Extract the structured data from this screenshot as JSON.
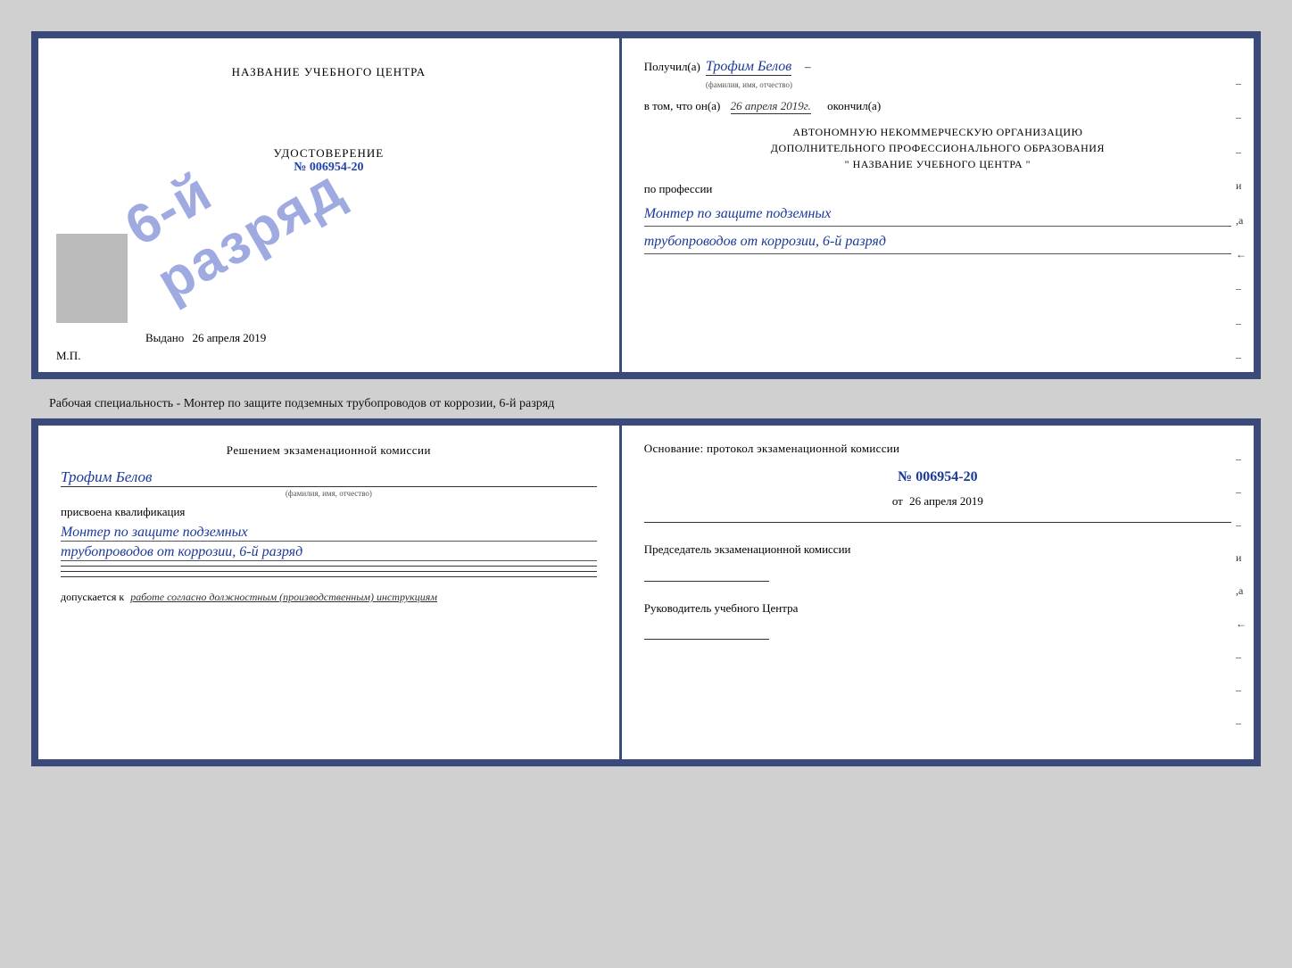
{
  "page": {
    "background": "#d0d0d0"
  },
  "cert_top": {
    "left": {
      "title": "НАЗВАНИЕ УЧЕБНОГО ЦЕНТРА",
      "stamp_text": "6-й разряд",
      "udost_label": "УДОСТОВЕРЕНИЕ",
      "udost_num": "№ 006954-20",
      "vydano_label": "Выдано",
      "vydano_date": "26 апреля 2019",
      "mp_label": "М.П."
    },
    "right": {
      "poluchil_label": "Получил(а)",
      "poluchil_name": "Трофим Белов",
      "poluchil_hint": "(фамилия, имя, отчество)",
      "vtom_label": "в том, что он(а)",
      "date_handwritten": "26 апреля 2019г.",
      "okonchil_label": "окончил(а)",
      "org_line1": "АВТОНОМНУЮ НЕКОММЕРЧЕСКУЮ ОРГАНИЗАЦИЮ",
      "org_line2": "ДОПОЛНИТЕЛЬНОГО ПРОФЕССИОНАЛЬНОГО ОБРАЗОВАНИЯ",
      "org_line3": "\"  НАЗВАНИЕ УЧЕБНОГО ЦЕНТРА  \"",
      "po_professii": "по профессии",
      "profession_line1": "Монтер по защите подземных",
      "profession_line2": "трубопроводов от коррозии, 6-й разряд",
      "side_dashes": [
        "-",
        "-",
        "-",
        "и",
        ",а",
        "←",
        "-",
        "-",
        "-"
      ]
    }
  },
  "middle_text": {
    "text": "Рабочая специальность - Монтер по защите подземных трубопроводов от коррозии, 6-й разряд"
  },
  "cert_bottom": {
    "left": {
      "title": "Решением экзаменационной комиссии",
      "name": "Трофим Белов",
      "name_hint": "(фамилия, имя, отчество)",
      "prisvoena": "присвоена квалификация",
      "profession_line1": "Монтер по защите подземных",
      "profession_line2": "трубопроводов от коррозии, 6-й разряд",
      "dopuskaetsya_label": "допускается к",
      "dopuskaetsya_text": "работе согласно должностным (производственным) инструкциям"
    },
    "right": {
      "osnov_title": "Основание: протокол экзаменационной комиссии",
      "protocol_num": "№  006954-20",
      "ot_label": "от",
      "ot_date": "26 апреля 2019",
      "predsedatel_label": "Председатель экзаменационной комиссии",
      "rukovoditel_label": "Руководитель учебного Центра",
      "side_dashes": [
        "-",
        "-",
        "-",
        "и",
        ",а",
        "←",
        "-",
        "-",
        "-"
      ]
    }
  }
}
